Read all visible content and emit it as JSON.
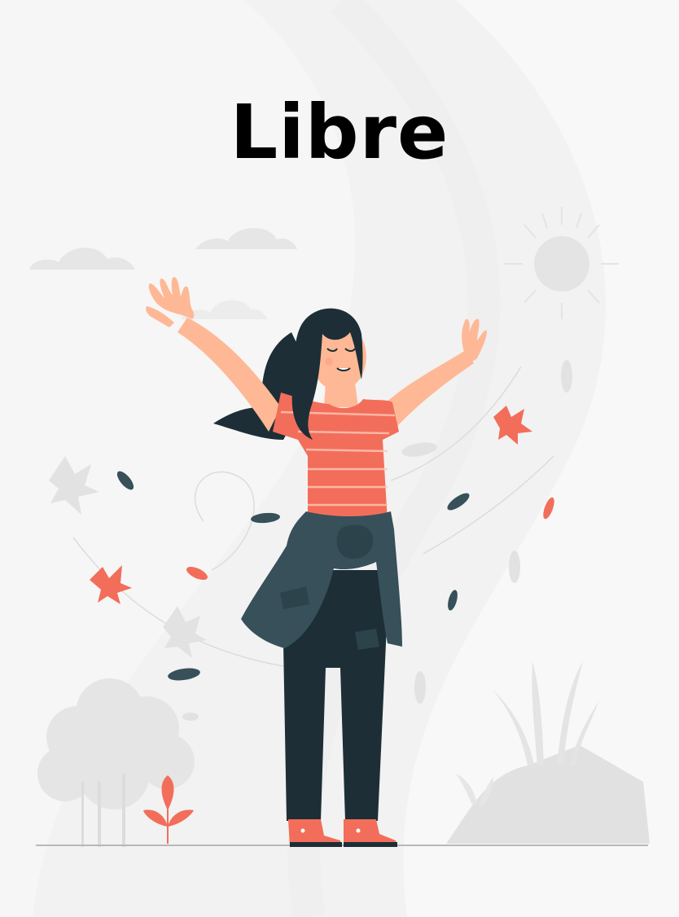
{
  "title": "Libre",
  "colors": {
    "background": "#f3f3f3",
    "accent": "#f26e5a",
    "dark": "#1d2e36",
    "jacket": "#37505a",
    "skin": "#ffb895",
    "muted": "#e3e3e3"
  },
  "illustration": {
    "subject": "woman-arms-raised",
    "elements": [
      "sun-icon",
      "cloud-icon",
      "leaf-icon",
      "bush-icon",
      "rock-icon",
      "grass-icon",
      "plant-icon"
    ]
  }
}
